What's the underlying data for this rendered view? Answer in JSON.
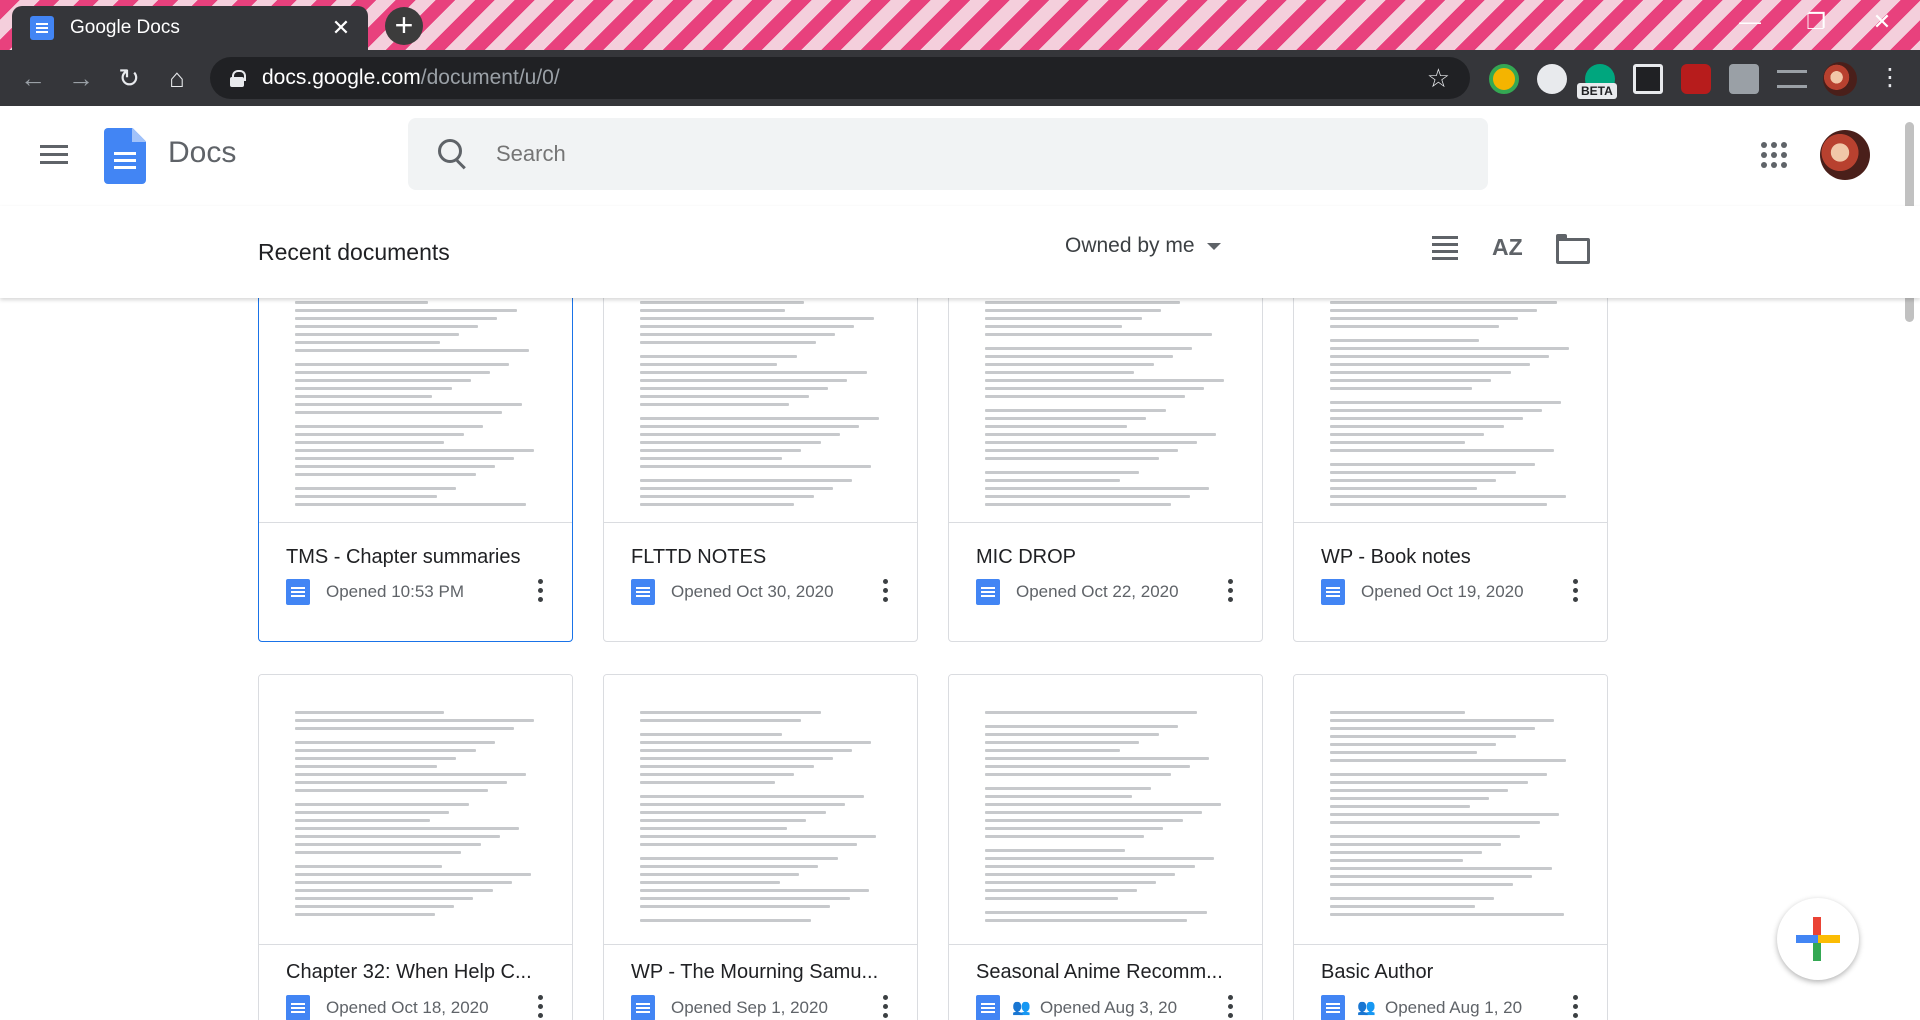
{
  "browser": {
    "tab_title": "Google Docs",
    "tab_close": "✕",
    "new_tab": "+",
    "url_host": "docs.google.com",
    "url_path": "/document/u/0/",
    "back": "←",
    "forward": "→",
    "reload": "↻",
    "home": "⌂",
    "bookmark": "☆",
    "ext_beta_label": "BETA",
    "min": "—",
    "max": "❐",
    "close": "✕"
  },
  "app": {
    "name": "Docs",
    "search_placeholder": "Search"
  },
  "subheader": {
    "title": "Recent documents",
    "owner_filter": "Owned by me",
    "sort_label": "AZ"
  },
  "documents": [
    {
      "title": "TMS - Chapter summaries",
      "opened": "Opened 10:53 PM",
      "shared": false
    },
    {
      "title": "FLTTD NOTES",
      "opened": "Opened Oct 30, 2020",
      "shared": false
    },
    {
      "title": "MIC DROP",
      "opened": "Opened Oct 22, 2020",
      "shared": false
    },
    {
      "title": "WP - Book notes",
      "opened": "Opened Oct 19, 2020",
      "shared": false
    },
    {
      "title": "Chapter 32: When Help C...",
      "opened": "Opened Oct 18, 2020",
      "shared": false
    },
    {
      "title": "WP - The Mourning Samu...",
      "opened": "Opened Sep 1, 2020",
      "shared": false
    },
    {
      "title": "Seasonal Anime Recomm...",
      "opened": "Opened Aug 3, 20",
      "shared": true
    },
    {
      "title": "Basic Author",
      "opened": "Opened Aug 1, 20",
      "shared": true
    }
  ],
  "colors": {
    "accent_blue": "#4285f4",
    "selected_border": "#1a73e8",
    "chrome_dark": "#35363a",
    "tab_stripe_pink": "#e8417d"
  }
}
